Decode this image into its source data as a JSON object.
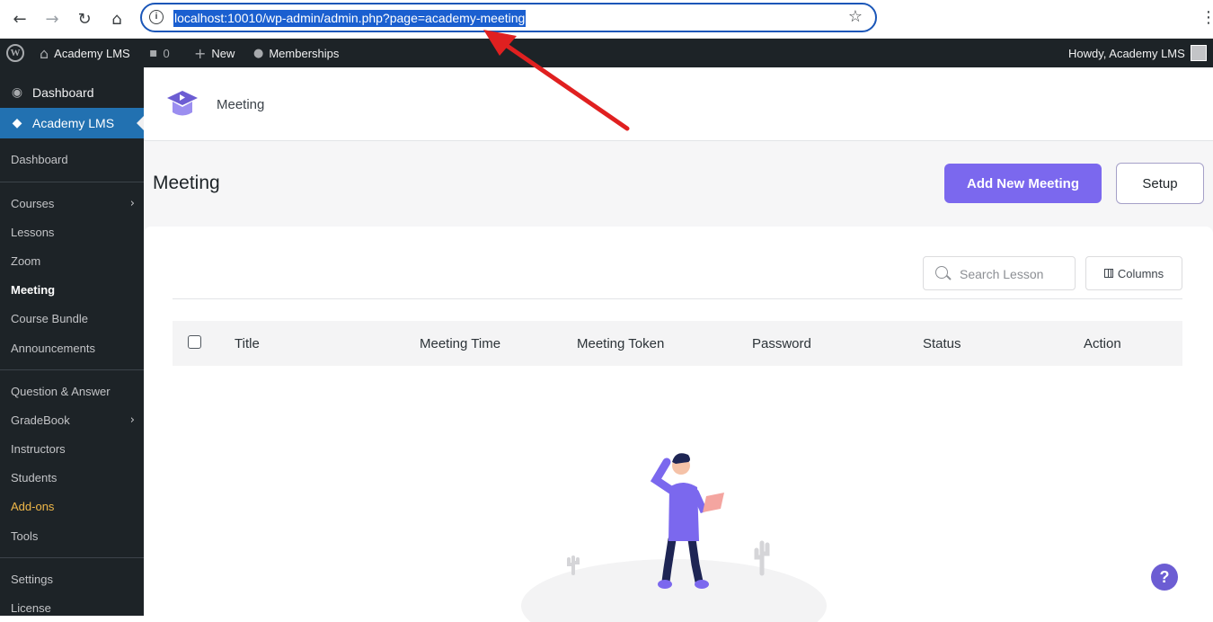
{
  "browser": {
    "url": "localhost:10010/wp-admin/admin.php?page=academy-meeting",
    "nav_icons": [
      "back-icon",
      "forward-icon",
      "reload-icon",
      "home-icon"
    ],
    "colors": {
      "url_outline": "#1a56b8",
      "url_highlight": "#1a5fd0"
    }
  },
  "adminbar": {
    "site_name": "Academy LMS",
    "comments_count": "0",
    "new_label": "New",
    "memberships_label": "Memberships",
    "howdy": "Howdy, Academy LMS"
  },
  "sidebar": {
    "dashboard": "Dashboard",
    "academy": "Academy LMS",
    "items": [
      {
        "label": "Dashboard"
      },
      {
        "label": "Courses"
      },
      {
        "label": "Lessons"
      },
      {
        "label": "Zoom"
      },
      {
        "label": "Meeting"
      },
      {
        "label": "Course Bundle"
      },
      {
        "label": "Announcements"
      },
      {
        "label": "Question & Answer"
      },
      {
        "label": "GradeBook"
      },
      {
        "label": "Instructors"
      },
      {
        "label": "Students"
      },
      {
        "label": "Add-ons"
      },
      {
        "label": "Tools"
      },
      {
        "label": "Settings"
      },
      {
        "label": "License"
      }
    ],
    "colors": {
      "bg": "#1d2327",
      "active": "#2271b1",
      "addons": "#f0b849"
    }
  },
  "header": {
    "breadcrumb_title": "Meeting",
    "page_title": "Meeting",
    "add_button": "Add New Meeting",
    "setup_button": "Setup"
  },
  "table": {
    "search_placeholder": "Search Lesson",
    "columns_button": "Columns",
    "headers": [
      "Title",
      "Meeting Time",
      "Meeting Token",
      "Password",
      "Status",
      "Action"
    ]
  },
  "help_label": "?",
  "accent": "#7b68ee"
}
